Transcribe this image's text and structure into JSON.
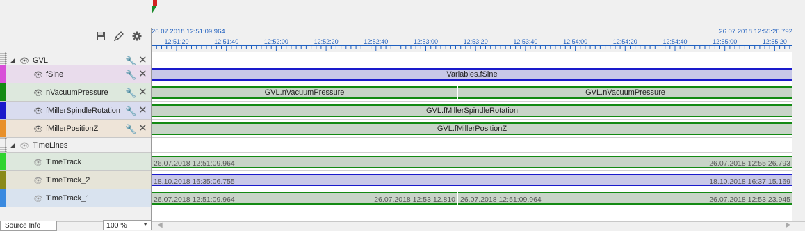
{
  "toolbar": {
    "save_icon": "floppy-disk-icon",
    "brush_icon": "brush-icon",
    "settings_icon": "gear-icon"
  },
  "ruler": {
    "start_time": "26.07.2018 12:51:09.964",
    "end_time": "26.07.2018 12:55:26.792",
    "ticks": [
      "12:51:20",
      "12:51:40",
      "12:52:00",
      "12:52:20",
      "12:52:40",
      "12:53:00",
      "12:53:20",
      "12:53:40",
      "12:54:00",
      "12:54:20",
      "12:54:40",
      "12:55:00",
      "12:55:20"
    ]
  },
  "tree": [
    {
      "label": "GVL",
      "type": "group",
      "color": "#f0f0f0"
    },
    {
      "label": "fSine",
      "type": "channel",
      "color": "#d84fd8",
      "bg": "#e9dcec"
    },
    {
      "label": "nVacuumPressure",
      "type": "channel",
      "color": "#138a13",
      "bg": "#dde8dd"
    },
    {
      "label": "fMillerSpindleRotation",
      "type": "channel",
      "color": "#1a1acb",
      "bg": "#d9dcef"
    },
    {
      "label": "fMillerPositionZ",
      "type": "channel",
      "color": "#e8902a",
      "bg": "#eee4d8"
    },
    {
      "label": "TimeLines",
      "type": "group",
      "color": "#f0f0f0"
    },
    {
      "label": "TimeTrack",
      "type": "channel",
      "color": "#2fd42f",
      "bg": "#dde8dd"
    },
    {
      "label": "TimeTrack_2",
      "type": "channel",
      "color": "#8a8a1a",
      "bg": "#e6e4d8"
    },
    {
      "label": "TimeTrack_1",
      "type": "channel",
      "color": "#3a8ae0",
      "bg": "#d9e3ef"
    }
  ],
  "tracks": {
    "fsine": {
      "label": "Variables.fSine"
    },
    "vacuum": {
      "label_a": "GVL.nVacuumPressure",
      "label_b": "GVL.nVacuumPressure"
    },
    "spindle": {
      "label": "GVL.fMillerSpindleRotation"
    },
    "posz": {
      "label": "GVL.fMillerPositionZ"
    },
    "timetrack": {
      "start": "26.07.2018 12:51:09.964",
      "end": "26.07.2018 12:55:26.793"
    },
    "timetrack2": {
      "start": "18.10.2018 16:35:06.755",
      "end": "18.10.2018 16:37:15.169"
    },
    "timetrack1": {
      "a_start": "26.07.2018 12:51:09.964",
      "a_end": "26.07.2018 12:53:12.810",
      "b_start": "26.07.2018 12:51:09.964",
      "b_end": "26.07.2018 12:53:23.945"
    }
  },
  "bottom": {
    "source_tab": "Source Info",
    "zoom": "100 %"
  },
  "colors": {
    "purple_bar": "#c8c8e8",
    "green_bar": "#c8d4c8",
    "accent": "#1f5fbf"
  }
}
